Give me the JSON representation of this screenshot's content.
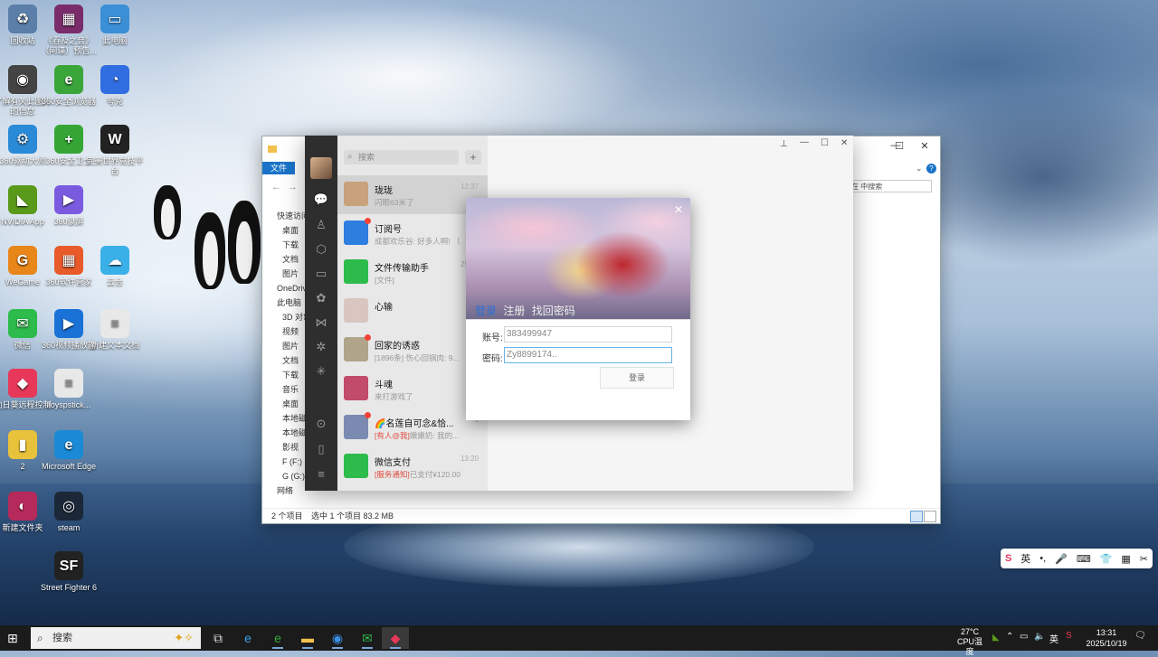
{
  "desktop": {
    "icons": [
      {
        "label": "回收站",
        "glyph": "♻",
        "color": "#5b7fa8"
      },
      {
        "label": "《吞及之音》（间谍）预告...",
        "glyph": "▦",
        "color": "#7a2c6a"
      },
      {
        "label": "此电脑",
        "glyph": "▭",
        "color": "#3a8fd6"
      },
      {
        "label": "了解有关此图片的信息",
        "glyph": "◉",
        "color": "#444"
      },
      {
        "label": "360安全浏览器",
        "glyph": "e",
        "color": "#3aa63a"
      },
      {
        "label": "夸克",
        "glyph": "◔",
        "color": "#2f6de0"
      },
      {
        "label": "360驱动大师",
        "glyph": "⚙",
        "color": "#2b8ad8"
      },
      {
        "label": "360安全卫士",
        "glyph": "+",
        "color": "#35a635"
      },
      {
        "label": "完美世界竞技平台",
        "glyph": "W",
        "color": "#222"
      },
      {
        "label": "NVIDIA App",
        "glyph": "◣",
        "color": "#5a9a1a"
      },
      {
        "label": "360录屏",
        "glyph": "▶",
        "color": "#7a5be0"
      },
      {
        "label": "WeGame",
        "glyph": "G",
        "color": "#e8861a"
      },
      {
        "label": "360软件管家",
        "glyph": "▦",
        "color": "#e85a2a"
      },
      {
        "label": "云台",
        "glyph": "☁",
        "color": "#3ab0e8"
      },
      {
        "label": "微信",
        "glyph": "✉",
        "color": "#2dbb4b"
      },
      {
        "label": "360视频播放器",
        "glyph": "▶",
        "color": "#1a72d6"
      },
      {
        "label": "新建文本文档",
        "glyph": "≡",
        "color": "#e8e8e8"
      },
      {
        "label": "向日葵远程控制",
        "glyph": "◆",
        "color": "#e8385a"
      },
      {
        "label": "lloyspstick...",
        "glyph": "≡",
        "color": "#e8e8e8"
      },
      {
        "label": "2",
        "glyph": "▮",
        "color": "#e8c23a"
      },
      {
        "label": "Microsoft Edge",
        "glyph": "e",
        "color": "#1a8ad6"
      },
      {
        "label": "新建文件夹",
        "glyph": "◐",
        "color": "#b52a5a"
      },
      {
        "label": "steam",
        "glyph": "◎",
        "color": "#1b2838"
      },
      {
        "label": "Street Fighter 6",
        "glyph": "SF",
        "color": "#222"
      }
    ],
    "ime": [
      "S",
      "英",
      "•,",
      "🎤",
      "⌨",
      "👕",
      "▦",
      "✂"
    ]
  },
  "explorer": {
    "tab_file": "文件",
    "search_placeholder": "在 中搜索",
    "sidebar": [
      "快速访问",
      "桌面",
      "下载",
      "文档",
      "图片",
      "OneDrive",
      "此电脑",
      "3D 对象",
      "视频",
      "图片",
      "文档",
      "下载",
      "音乐",
      "桌面",
      "本地磁盘",
      "本地磁盘",
      "影视",
      "F (F:)",
      "G (G:)",
      "网络"
    ],
    "status_items": "2 个项目",
    "status_selected": "选中 1 个项目  83.2 MB"
  },
  "chat": {
    "search_placeholder": "搜索",
    "conversations": [
      {
        "name": "珑珑",
        "preview": "闪眼63米了",
        "time": "12:37",
        "dot": false,
        "color": "#c8a27a"
      },
      {
        "name": "订阅号",
        "preview": "成都欢乐谷: 好多人啊! （小",
        "time": "1",
        "dot": true,
        "color": "#2e7ee0"
      },
      {
        "name": "文件传输助手",
        "preview": "[文件]",
        "time": "25/10",
        "dot": false,
        "color": "#2dbb4b"
      },
      {
        "name": "心输",
        "preview": "",
        "time": "",
        "dot": false,
        "color": "#d9c6c0"
      },
      {
        "name": "回家的诱惑",
        "preview": "[1896条] 伤心回锅肉: 9...",
        "time": "1",
        "dot": true,
        "color": "#b0a58a"
      },
      {
        "name": "斗魂",
        "preview": "来打游戏了",
        "time": "1",
        "dot": false,
        "color": "#c24a6a"
      },
      {
        "name": "🌈名莲自可念&恰...",
        "preview": "[有人@我]",
        "preview_rest": "嫩嫩奶: 我的...",
        "time": "1",
        "dot": true,
        "color": "#7a8ab0"
      },
      {
        "name": "微信支付",
        "preview": "[服务通知]",
        "preview_rest": "已支付¥120.00",
        "time": "13:20",
        "dot": false,
        "color": "#2dbb4b"
      }
    ]
  },
  "login": {
    "tabs": [
      "登录",
      "注册",
      "找回密码"
    ],
    "account_label": "账号:",
    "account_value": "383499947",
    "password_label": "密码:",
    "password_value": "Zy8899174..",
    "submit_label": "登录"
  },
  "taskbar": {
    "search_placeholder": "搜索",
    "weather_temp": "27°C",
    "weather_label": "CPU温度",
    "lang": "英",
    "time": "13:31",
    "date": "2025/10/19"
  }
}
